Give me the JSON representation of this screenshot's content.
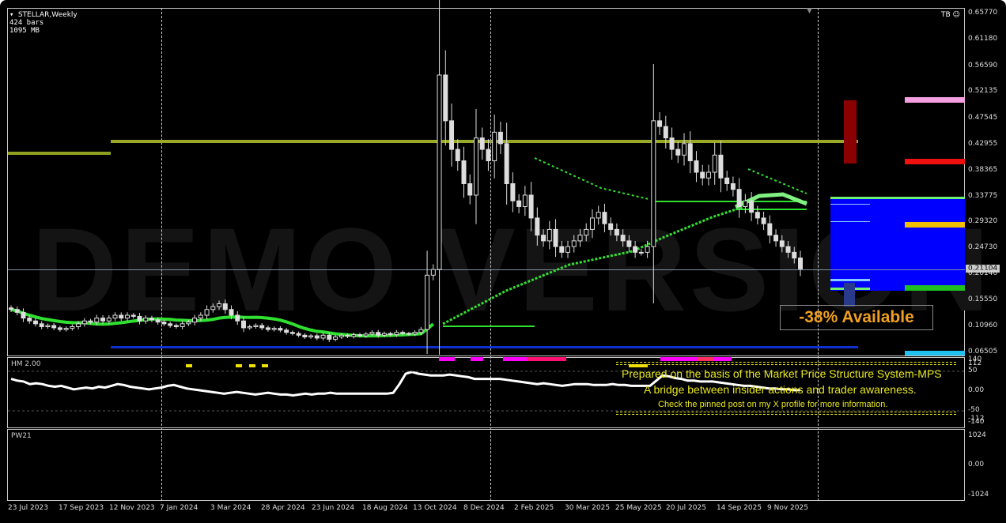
{
  "header": {
    "symbol": "STELLAR,Weekly",
    "bars": "424 bars",
    "memory": "1095 MB",
    "tb": "TB"
  },
  "watermark": "DEMO VERSION",
  "price_axis": [
    "0.65770",
    "0.61180",
    "0.56590",
    "0.52135",
    "0.47545",
    "0.42955",
    "0.38365",
    "0.33775",
    "0.29320",
    "0.24730",
    "0.20140",
    "0.15550",
    "0.10960",
    "0.06505"
  ],
  "current_price": "0.21104",
  "available_label": "-38% Available",
  "indicator": {
    "name": "HM 2.00",
    "axis": [
      "140",
      "112",
      "50",
      "0.00",
      "-50",
      "-112",
      "-140"
    ],
    "messages": [
      "Prepared on the basis of the Market Price Structure System-MPS",
      "A bridge between insider actions and trader awareness.",
      "Check the pinned post on my X profile for more information."
    ]
  },
  "pw": {
    "name": "PW21",
    "axis": [
      "1024",
      "0.00",
      "-1024"
    ]
  },
  "time_axis": [
    "23 Jul 2023",
    "17 Sep 2023",
    "12 Nov 2023",
    "7 Jan 2024",
    "3 Mar 2024",
    "28 Apr 2024",
    "23 Jun 2024",
    "18 Aug 2024",
    "13 Oct 2024",
    "8 Dec 2024",
    "2 Feb 2025",
    "30 Mar 2025",
    "25 May 2025",
    "20 Jul 2025",
    "14 Sep 2025",
    "9 Nov 2025"
  ],
  "chart_data": {
    "type": "candlestick",
    "ylim": [
      0.06505,
      0.6577
    ],
    "closes": [
      0.14,
      0.135,
      0.125,
      0.12,
      0.115,
      0.11,
      0.112,
      0.108,
      0.105,
      0.107,
      0.11,
      0.115,
      0.12,
      0.118,
      0.125,
      0.12,
      0.125,
      0.13,
      0.125,
      0.13,
      0.128,
      0.12,
      0.125,
      0.122,
      0.118,
      0.115,
      0.112,
      0.11,
      0.115,
      0.118,
      0.125,
      0.13,
      0.14,
      0.145,
      0.15,
      0.14,
      0.13,
      0.12,
      0.108,
      0.11,
      0.112,
      0.108,
      0.105,
      0.107,
      0.104,
      0.1,
      0.098,
      0.095,
      0.092,
      0.094,
      0.09,
      0.095,
      0.088,
      0.092,
      0.095,
      0.093,
      0.096,
      0.094,
      0.097,
      0.1,
      0.095,
      0.098,
      0.096,
      0.1,
      0.098,
      0.097,
      0.1,
      0.105,
      0.2,
      0.21,
      0.55,
      0.47,
      0.42,
      0.4,
      0.36,
      0.34,
      0.44,
      0.42,
      0.4,
      0.45,
      0.43,
      0.36,
      0.33,
      0.32,
      0.34,
      0.3,
      0.27,
      0.26,
      0.28,
      0.25,
      0.24,
      0.25,
      0.26,
      0.27,
      0.28,
      0.3,
      0.31,
      0.29,
      0.28,
      0.27,
      0.26,
      0.25,
      0.24,
      0.24,
      0.25,
      0.47,
      0.46,
      0.44,
      0.42,
      0.41,
      0.43,
      0.4,
      0.38,
      0.37,
      0.38,
      0.41,
      0.37,
      0.36,
      0.35,
      0.32,
      0.33,
      0.31,
      0.3,
      0.29,
      0.27,
      0.26,
      0.25,
      0.24,
      0.23,
      0.211
    ],
    "hm": [
      70,
      60,
      55,
      40,
      45,
      40,
      30,
      25,
      30,
      20,
      10,
      15,
      20,
      15,
      25,
      20,
      30,
      40,
      35,
      25,
      20,
      15,
      10,
      15,
      20,
      30,
      35,
      25,
      15,
      10,
      5,
      0,
      -5,
      -10,
      -15,
      -10,
      -5,
      -10,
      -15,
      -20,
      -15,
      -10,
      -15,
      -20,
      -20,
      -25,
      -20,
      -15,
      -20,
      -15,
      -15,
      -10,
      -15,
      -15,
      -15,
      -15,
      -15,
      -15,
      -15,
      -15,
      -15,
      -10,
      40,
      100,
      110,
      100,
      95,
      90,
      90,
      90,
      95,
      90,
      85,
      80,
      70,
      70,
      70,
      70,
      70,
      65,
      60,
      55,
      50,
      45,
      40,
      45,
      40,
      35,
      30,
      35,
      40,
      40,
      40,
      35,
      35,
      35,
      40,
      35,
      35,
      30,
      30,
      30,
      30,
      60,
      90,
      85,
      75,
      70,
      60,
      60,
      55,
      55,
      55,
      50,
      45,
      40,
      35,
      30,
      30,
      25,
      20,
      15,
      15,
      10,
      10,
      5,
      5
    ]
  }
}
